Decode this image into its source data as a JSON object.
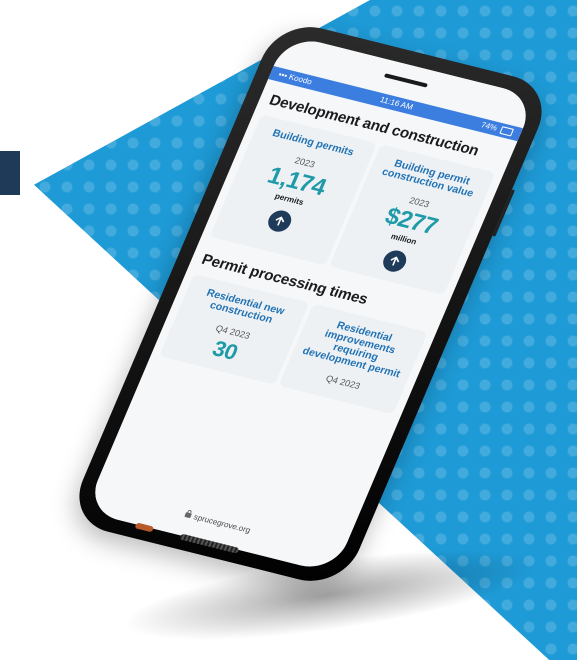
{
  "status_bar": {
    "carrier": "Koodo",
    "time": "11:16 AM",
    "battery": "74%"
  },
  "development": {
    "title": "Development and construction",
    "cards": [
      {
        "title": "Building permits",
        "year": "2023",
        "value": "1,174",
        "unit": "permits",
        "icon": "arrow-up-icon"
      },
      {
        "title": "Building permit construction value",
        "year": "2023",
        "value": "$277",
        "unit": "million",
        "icon": "arrow-up-icon"
      }
    ]
  },
  "processing": {
    "title": "Permit processing times",
    "cards": [
      {
        "title": "Residential new construction",
        "period": "Q4 2023",
        "value": "30"
      },
      {
        "title": "Residential improvements requiring development permit",
        "period": "Q4 2023"
      }
    ]
  },
  "url_bar": {
    "url": "sprucegrove.org"
  },
  "colors": {
    "background_blue": "#1e9ad6",
    "card_title_blue": "#2273b4",
    "value_teal": "#1e9aa8",
    "navy_accent": "#1f3a59"
  }
}
